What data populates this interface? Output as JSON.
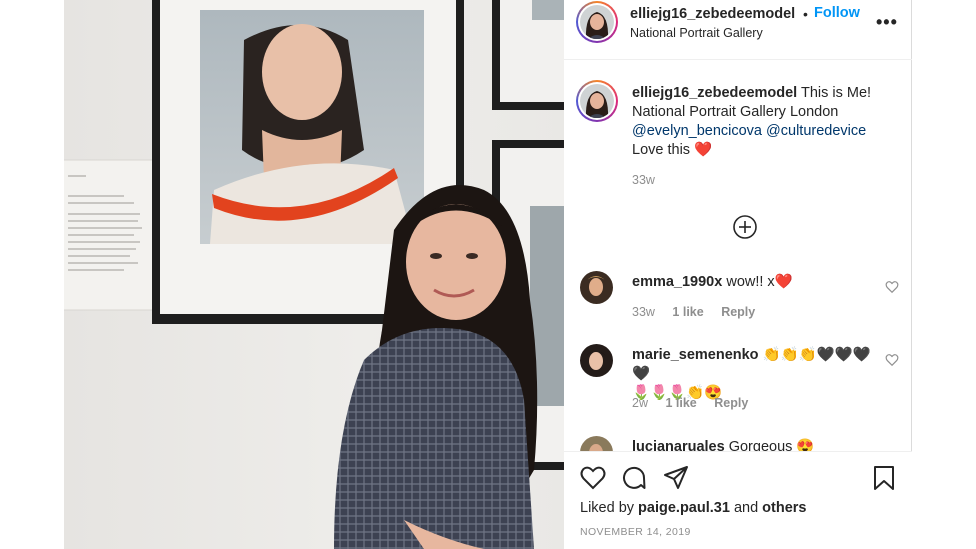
{
  "post": {
    "username": "elliejg16_zebedeemodel",
    "follow_separator": "•",
    "follow_label": "Follow",
    "location": "National Portrait Gallery",
    "more_icon": "more-horizontal-icon"
  },
  "caption": {
    "username": "elliejg16_zebedeemodel",
    "text_line1": " This is Me!",
    "text_line2": "National Portrait Gallery London",
    "mention1": "@evelyn_bencicova",
    "mention2": "@culturedevice",
    "text_line4": "Love this ",
    "heart": "❤️",
    "time": "33w"
  },
  "comments": [
    {
      "username": "emma_1990x",
      "text": " wow!! x❤️",
      "time": "33w",
      "likes": "1 like",
      "reply": "Reply"
    },
    {
      "username": "marie_semenenko",
      "text": " 👏👏👏🖤🖤🖤🖤",
      "text2": "🌷🌷🌷👏😍",
      "time": "2w",
      "likes": "1 like",
      "reply": "Reply"
    },
    {
      "username": "lucianaruales",
      "text": " Gorgeous 😍"
    }
  ],
  "actions": {
    "liked_prefix": "Liked by ",
    "liked_user": "paige.paul.31",
    "liked_mid": " and ",
    "liked_others": "others",
    "date": "NOVEMBER 14, 2019"
  },
  "colors": {
    "follow": "#0095f6",
    "mention": "#00376b",
    "secondary_text": "#8e8e8e",
    "scarf": "#e2431e"
  }
}
